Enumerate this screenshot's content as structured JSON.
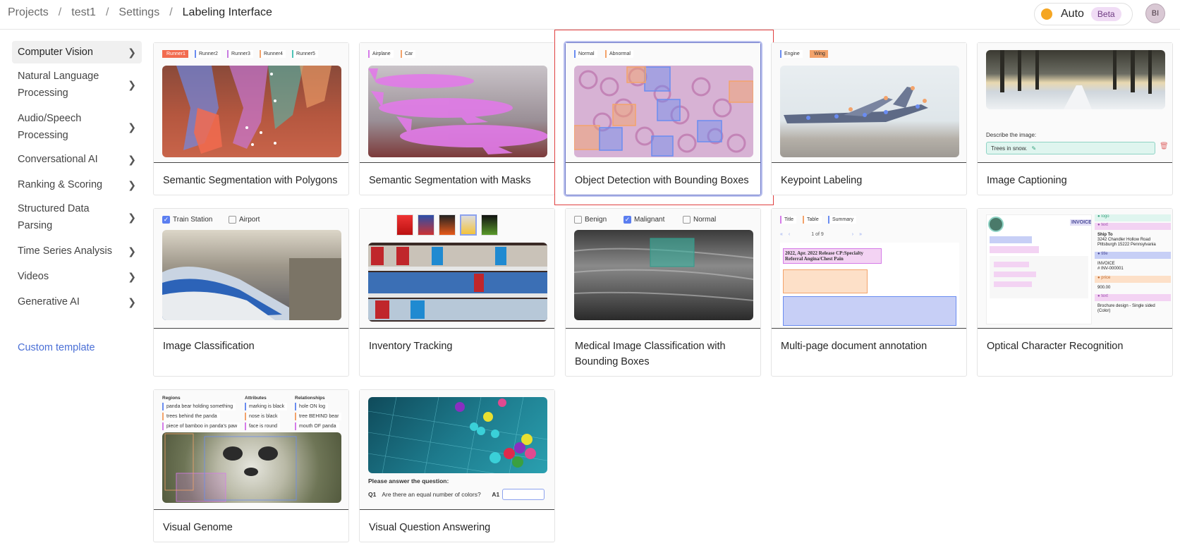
{
  "breadcrumb": [
    "Projects",
    "test1",
    "Settings",
    "Labeling Interface"
  ],
  "header": {
    "auto_label": "Auto",
    "beta_label": "Beta",
    "avatar_initials": "BI"
  },
  "sidebar": {
    "items": [
      "Computer Vision",
      "Natural Language Processing",
      "Audio/Speech Processing",
      "Conversational AI",
      "Ranking & Scoring",
      "Structured Data Parsing",
      "Time Series Analysis",
      "Videos",
      "Generative AI"
    ],
    "custom_template": "Custom template"
  },
  "cards": [
    {
      "title": "Semantic Segmentation with Polygons",
      "tags": [
        "Runner1",
        "Runner2",
        "Runner3",
        "Runner4",
        "Runner5"
      ]
    },
    {
      "title": "Semantic Segmentation with Masks",
      "tags": [
        "Airplane",
        "Car"
      ]
    },
    {
      "title": "Object Detection with Bounding Boxes",
      "tags": [
        "Normal",
        "Abnormal"
      ]
    },
    {
      "title": "Keypoint Labeling",
      "tags": [
        "Engine",
        "Wing"
      ]
    },
    {
      "title": "Image Captioning",
      "caption_prompt": "Describe the image:",
      "caption_value": "Trees in snow."
    },
    {
      "title": "Image Classification",
      "choices": [
        "Train Station",
        "Airport"
      ]
    },
    {
      "title": "Inventory Tracking"
    },
    {
      "title": "Medical Image Classification with Bounding Boxes",
      "choices": [
        "Benign",
        "Malignant",
        "Normal"
      ]
    },
    {
      "title": "Multi-page document annotation",
      "tags": [
        "Title",
        "Table",
        "Summary"
      ],
      "pager": "1 of 9",
      "doc_heading": "2022, Apr. 2022 Release CP:Specialty Referral Angina/Chest Pain"
    },
    {
      "title": "Optical Character Recognition",
      "invoice": "INVOICE",
      "ship_to": "Ship To",
      "address": "3242 Chandler Hollow Road Pittsburgh 15222 Pennsylvania",
      "invoice_no": "# INV-000001",
      "price": "900.00",
      "desc": "Brochure design - Single sided (Color)"
    },
    {
      "title": "Visual Genome",
      "regions_head": "Regions",
      "attributes_head": "Attributes",
      "relationships_head": "Relationships",
      "regions": [
        "panda bear holding something",
        "trees behind the panda",
        "piece of bamboo in panda's paw"
      ],
      "attributes": [
        "marking is black",
        "nose is black",
        "face is round"
      ],
      "relationships": [
        "hole ON log",
        "tree BEHIND bear",
        "mouth OF panda"
      ]
    },
    {
      "title": "Visual Question Answering",
      "prompt": "Please answer the question:",
      "q_label": "Q1",
      "question": "Are there an equal number of colors?",
      "a_label": "A1"
    }
  ],
  "colors": {
    "accent": "#4a6fd6",
    "selected_border": "#6f7ac9",
    "highlight_frame": "#e04040",
    "auto_dot": "#f5a623"
  }
}
